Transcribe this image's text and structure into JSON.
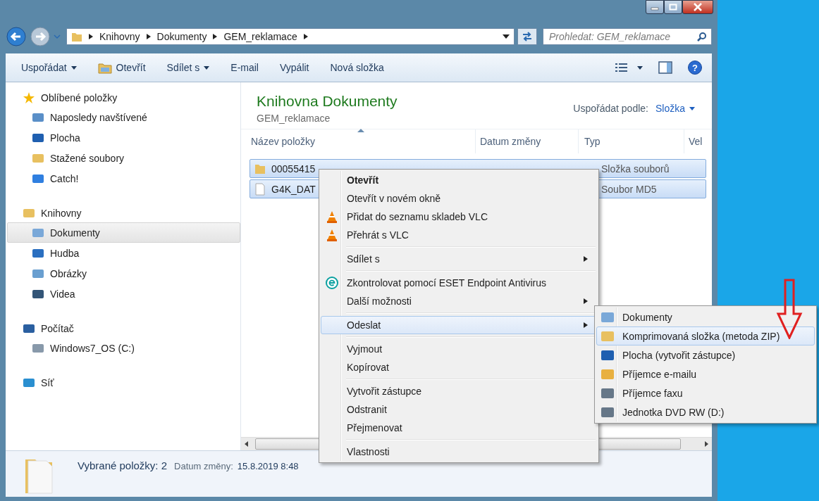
{
  "address": {
    "crumbs": [
      "Knihovny",
      "Dokumenty",
      "GEM_reklamace"
    ]
  },
  "search": {
    "placeholder": "Prohledat: GEM_reklamace"
  },
  "toolbar": [
    {
      "label": "Uspořádat",
      "kind": "dropdown"
    },
    {
      "label": "Otevřít",
      "kind": "icon"
    },
    {
      "label": "Sdílet s",
      "kind": "dropdown"
    },
    {
      "label": "E-mail",
      "kind": "plain"
    },
    {
      "label": "Vypálit",
      "kind": "plain"
    },
    {
      "label": "Nová složka",
      "kind": "plain"
    }
  ],
  "help_button": "?",
  "sidebar": {
    "groups": [
      {
        "label": "Oblíbené položky",
        "children": [
          {
            "label": "Naposledy navštívené",
            "selected": false
          },
          {
            "label": "Plocha",
            "selected": false
          },
          {
            "label": "Stažené soubory",
            "selected": false
          },
          {
            "label": "Catch!",
            "selected": false
          }
        ]
      },
      {
        "label": "Knihovny",
        "children": [
          {
            "label": "Dokumenty",
            "selected": true
          },
          {
            "label": "Hudba",
            "selected": false
          },
          {
            "label": "Obrázky",
            "selected": false
          },
          {
            "label": "Videa",
            "selected": false
          }
        ]
      },
      {
        "label": "Počítač",
        "children": [
          {
            "label": "Windows7_OS (C:)",
            "selected": false
          }
        ]
      },
      {
        "label": "Síť"
      }
    ]
  },
  "library": {
    "title": "Knihovna Dokumenty",
    "subtitle": "GEM_reklamace",
    "arrange_label": "Uspořádat podle:",
    "arrange_value": "Složka"
  },
  "table": {
    "columns": [
      "Název položky",
      "Datum změny",
      "Typ",
      "Vel"
    ],
    "rows": [
      {
        "name": "00055415",
        "type": "Složka souborů",
        "kind": "folder",
        "selected": true
      },
      {
        "name": "G4K_DAT",
        "type": "Soubor MD5",
        "kind": "file",
        "selected": true
      }
    ]
  },
  "context_menu": {
    "groups": [
      [
        {
          "label": "Otevřít",
          "default": true,
          "submenu": false,
          "kind": "plain",
          "selected": false
        },
        {
          "label": "Otevřít v novém okně",
          "default": false,
          "submenu": false,
          "kind": "plain",
          "selected": false
        },
        {
          "label": "Přidat do seznamu skladeb VLC",
          "default": false,
          "submenu": false,
          "kind": "vlc",
          "selected": false
        },
        {
          "label": "Přehrát s VLC",
          "default": false,
          "submenu": false,
          "kind": "vlc",
          "selected": false
        }
      ],
      [
        {
          "label": "Sdílet s",
          "default": false,
          "submenu": true,
          "kind": "plain",
          "selected": false
        }
      ],
      [
        {
          "label": "Zkontrolovat pomocí ESET Endpoint Antivirus",
          "default": false,
          "submenu": false,
          "kind": "antivirus",
          "selected": false
        },
        {
          "label": "Další možnosti",
          "default": false,
          "submenu": true,
          "kind": "plain",
          "selected": false
        }
      ],
      [
        {
          "label": "Odeslat",
          "default": false,
          "submenu": true,
          "kind": "plain",
          "selected": true
        }
      ],
      [
        {
          "label": "Vyjmout",
          "default": false,
          "submenu": false,
          "kind": "plain",
          "selected": false
        },
        {
          "label": "Kopírovat",
          "default": false,
          "submenu": false,
          "kind": "plain",
          "selected": false
        }
      ],
      [
        {
          "label": "Vytvořit zástupce",
          "default": false,
          "submenu": false,
          "kind": "plain",
          "selected": false
        },
        {
          "label": "Odstranit",
          "default": false,
          "submenu": false,
          "kind": "plain",
          "selected": false
        },
        {
          "label": "Přejmenovat",
          "default": false,
          "submenu": false,
          "kind": "plain",
          "selected": false
        }
      ],
      [
        {
          "label": "Vlastnosti",
          "default": false,
          "submenu": false,
          "kind": "plain",
          "selected": false
        }
      ]
    ]
  },
  "send_to_menu": {
    "items": [
      {
        "label": "Dokumenty",
        "selected": false
      },
      {
        "label": "Komprimovaná složka (metoda ZIP)",
        "selected": true
      },
      {
        "label": "Plocha (vytvořit zástupce)",
        "selected": false
      },
      {
        "label": "Příjemce e-mailu",
        "selected": false
      },
      {
        "label": "Příjemce faxu",
        "selected": false
      },
      {
        "label": "Jednotka DVD RW (D:)",
        "selected": false
      }
    ]
  },
  "status_bar": {
    "selection": "Vybrané položky: 2",
    "date_label": "Datum změny:",
    "date_value": "15.8.2019 8:48"
  }
}
